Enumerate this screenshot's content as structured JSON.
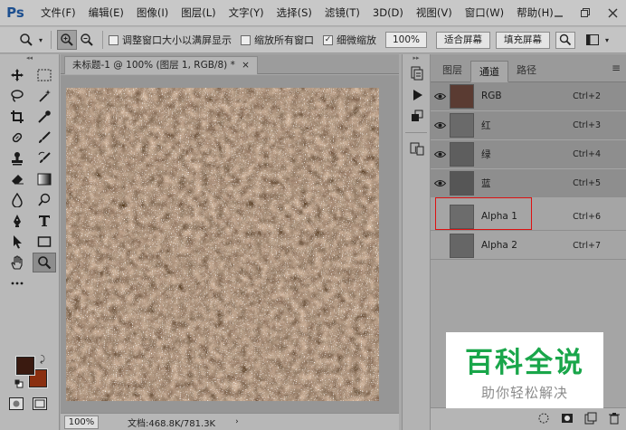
{
  "app": {
    "logo": "Ps",
    "menu": [
      "文件(F)",
      "编辑(E)",
      "图像(I)",
      "图层(L)",
      "文字(Y)",
      "选择(S)",
      "滤镜(T)",
      "3D(D)",
      "视图(V)",
      "窗口(W)",
      "帮助(H)"
    ]
  },
  "options": {
    "resize_windows": "调整窗口大小以满屏显示",
    "zoom_all": "缩放所有窗口",
    "scrubby_zoom": "细微缩放",
    "zoom_value": "100%",
    "fit_screen": "适合屏幕",
    "fill_screen": "填充屏幕",
    "resize_checked": false,
    "zoom_all_checked": false,
    "scrubby_checked": true
  },
  "document": {
    "tab_title": "未标题-1 @ 100% (图层 1, RGB/8) *",
    "zoom": "100%",
    "info": "文档:468.8K/781.3K"
  },
  "panel": {
    "tabs": [
      "图层",
      "通道",
      "路径"
    ],
    "active_tab": "通道",
    "channels": [
      {
        "name": "RGB",
        "shortcut": "Ctrl+2",
        "visible": true
      },
      {
        "name": "红",
        "shortcut": "Ctrl+3",
        "visible": true
      },
      {
        "name": "绿",
        "shortcut": "Ctrl+4",
        "visible": true
      },
      {
        "name": "蓝",
        "shortcut": "Ctrl+5",
        "visible": true
      },
      {
        "name": "Alpha 1",
        "shortcut": "Ctrl+6",
        "visible": false
      },
      {
        "name": "Alpha 2",
        "shortcut": "Ctrl+7",
        "visible": false
      }
    ]
  },
  "colors": {
    "foreground": "#3a1a10",
    "background": "#8a2f10",
    "highlight": "#dd1111",
    "watermark_green": "#19a64a"
  },
  "watermark": {
    "title": "百科全说",
    "subtitle": "助你轻松解决"
  }
}
